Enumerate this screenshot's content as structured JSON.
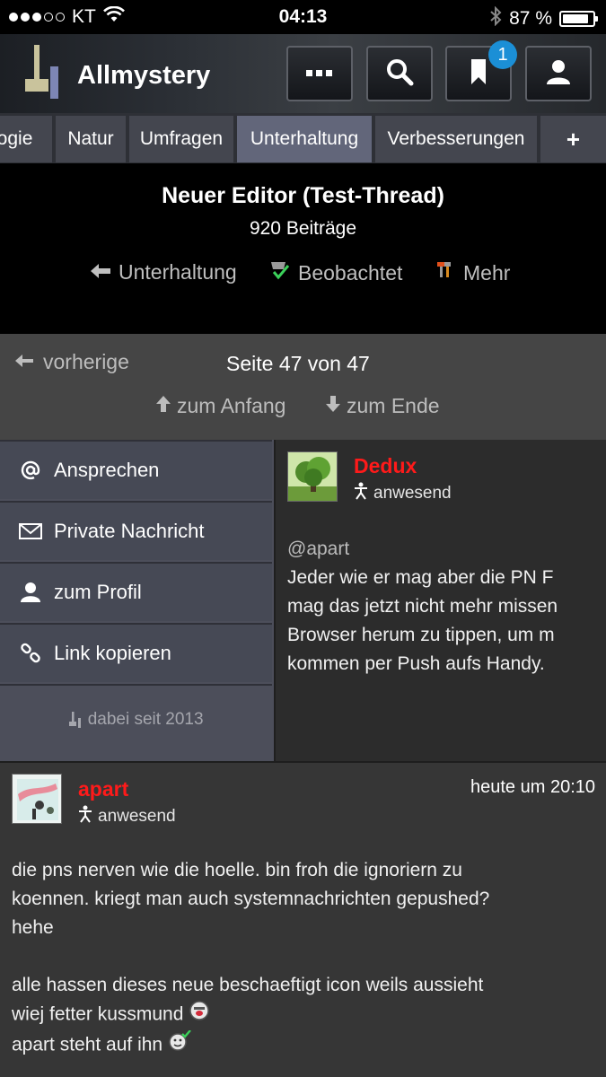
{
  "status": {
    "carrier": "KT",
    "time": "04:13",
    "battery": "87 %",
    "battery_fraction": 0.87
  },
  "header": {
    "brand": "Allmystery",
    "notification_count": "1"
  },
  "categories": [
    {
      "label": "logie",
      "active": false
    },
    {
      "label": "Natur",
      "active": false
    },
    {
      "label": "Umfragen",
      "active": false
    },
    {
      "label": "Unterhaltung",
      "active": true
    },
    {
      "label": "Verbesserungen",
      "active": false
    }
  ],
  "categories_more": "+",
  "thread": {
    "title": "Neuer Editor (Test-Thread)",
    "post_count": "920 Beiträge",
    "links": {
      "back": "Unterhaltung",
      "watch": "Beobachtet",
      "more": "Mehr"
    }
  },
  "pager": {
    "prev": "vorherige",
    "page": "Seite 47 von 47",
    "to_start": "zum Anfang",
    "to_end": "zum Ende"
  },
  "user_menu": {
    "items": [
      {
        "label": "Ansprechen",
        "icon": "at-icon"
      },
      {
        "label": "Private Nachricht",
        "icon": "envelope-icon"
      },
      {
        "label": "zum Profil",
        "icon": "user-icon"
      },
      {
        "label": "Link kopieren",
        "icon": "link-icon"
      }
    ],
    "member_since": "dabei seit 2013"
  },
  "posts": [
    {
      "author": "Dedux",
      "presence": "anwesend",
      "lines": [
        "@apart",
        "Jeder wie er mag aber die PN F",
        "mag das jetzt nicht mehr missen",
        "Browser herum zu tippen, um m",
        "kommen per Push aufs Handy."
      ]
    },
    {
      "author": "apart",
      "presence": "anwesend",
      "time": "heute um 20:10",
      "lines": [
        "die pns nerven wie die hoelle. bin froh die ignoriern zu",
        "koennen. kriegt man auch systemnachrichten gepushed?",
        "hehe",
        "",
        "alle hassen dieses neue beschaeftigt icon weils aussieht",
        "wiej fetter kussmund",
        "apart steht auf ihn"
      ]
    }
  ],
  "colors": {
    "author": "#ff1a1a",
    "active_tab": "#62667a",
    "badge": "#1b8fd6"
  }
}
